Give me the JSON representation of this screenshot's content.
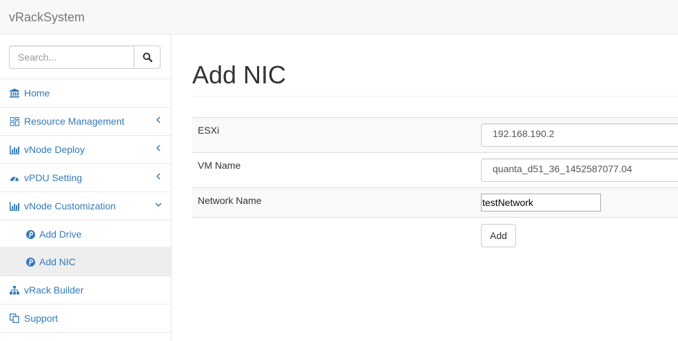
{
  "app": {
    "brand": "vRackSystem"
  },
  "search": {
    "placeholder": "Search..."
  },
  "sidebar": {
    "items": [
      {
        "label": "Home",
        "icon": "bank-icon"
      },
      {
        "label": "Resource Management",
        "icon": "dashboard-icon",
        "expandable": true
      },
      {
        "label": "vNode Deploy",
        "icon": "bar-chart-icon",
        "expandable": true
      },
      {
        "label": "vPDU Setting",
        "icon": "gauge-icon",
        "expandable": true
      },
      {
        "label": "vNode Customization",
        "icon": "bar-chart-icon",
        "expanded": true
      },
      {
        "label": "vRack Builder",
        "icon": "sitemap-icon"
      },
      {
        "label": "Support",
        "icon": "copy-icon"
      }
    ],
    "subitems": [
      {
        "label": "Add Drive",
        "icon": "pinterest-icon"
      },
      {
        "label": "Add NIC",
        "icon": "pinterest-icon",
        "active": true
      }
    ]
  },
  "main": {
    "title": "Add NIC",
    "form": {
      "esxi_label": "ESXi",
      "esxi_value": "192.168.190.2",
      "vm_label": "VM Name",
      "vm_value": "quanta_d51_36_1452587077.04",
      "network_label": "Network Name",
      "network_value": "testNetwork",
      "submit_label": "Add"
    }
  },
  "colors": {
    "link": "#337ab7",
    "border": "#e7e7e7",
    "active_bg": "#eeeeee",
    "stripe": "#f9f9f9"
  }
}
